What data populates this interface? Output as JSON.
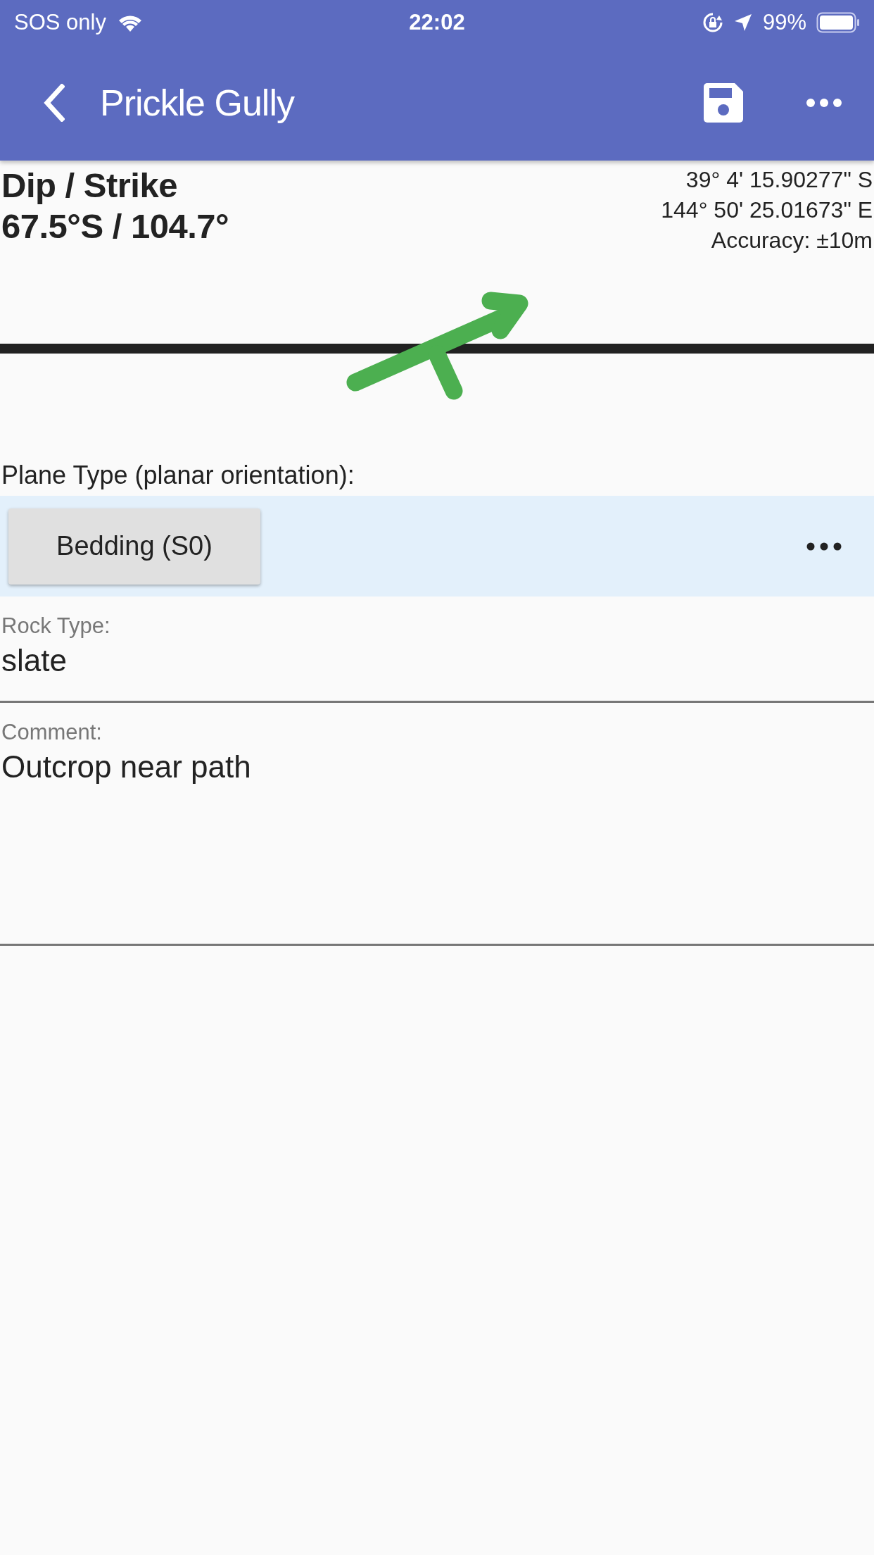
{
  "status_bar": {
    "carrier": "SOS only",
    "time": "22:02",
    "battery": "99%"
  },
  "app_bar": {
    "title": "Prickle Gully"
  },
  "measurement": {
    "label": "Dip / Strike",
    "value": "67.5°S / 104.7°"
  },
  "location": {
    "latitude": "39° 4' 15.90277\" S",
    "longitude": "144° 50' 25.01673\" E",
    "accuracy": "Accuracy: ±10m"
  },
  "plane_type": {
    "label": "Plane Type (planar orientation):",
    "value": "Bedding (S0)"
  },
  "fields": [
    {
      "kind": "single",
      "label": "Rock Type:",
      "value": "slate"
    },
    {
      "kind": "multiline",
      "label": "Comment:",
      "value": "Outcrop near path"
    }
  ]
}
